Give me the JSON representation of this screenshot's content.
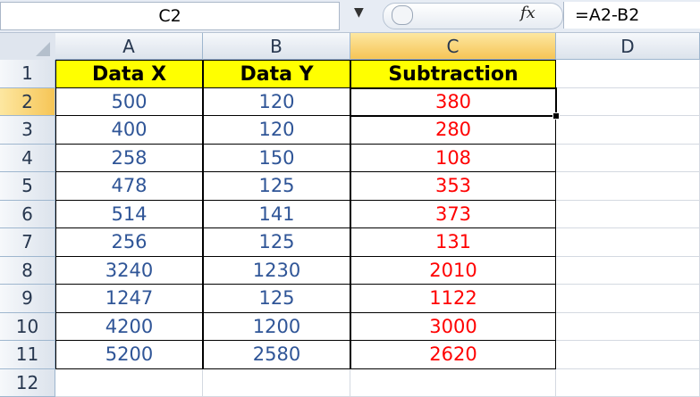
{
  "formula_bar": {
    "name_box": "C2",
    "fx_symbol": "fx",
    "formula": "=A2-B2"
  },
  "columns": [
    "A",
    "B",
    "C",
    "D"
  ],
  "selected_column": "C",
  "rows": [
    "1",
    "2",
    "3",
    "4",
    "5",
    "6",
    "7",
    "8",
    "9",
    "10",
    "11",
    "12"
  ],
  "selected_row": "2",
  "headers": {
    "a": "Data X",
    "b": "Data Y",
    "c": "Subtraction"
  },
  "data": [
    {
      "a": "500",
      "b": "120",
      "c": "380"
    },
    {
      "a": "400",
      "b": "120",
      "c": "280"
    },
    {
      "a": "258",
      "b": "150",
      "c": "108"
    },
    {
      "a": "478",
      "b": "125",
      "c": "353"
    },
    {
      "a": "514",
      "b": "141",
      "c": "373"
    },
    {
      "a": "256",
      "b": "125",
      "c": "131"
    },
    {
      "a": "3240",
      "b": "1230",
      "c": "2010"
    },
    {
      "a": "1247",
      "b": "125",
      "c": "1122"
    },
    {
      "a": "4200",
      "b": "1200",
      "c": "3000"
    },
    {
      "a": "5200",
      "b": "2580",
      "c": "2620"
    }
  ],
  "colors": {
    "header_fill": "#ffff00",
    "value_text": "#2f5597",
    "result_text": "#ff0000",
    "selection": "#f6c556"
  }
}
